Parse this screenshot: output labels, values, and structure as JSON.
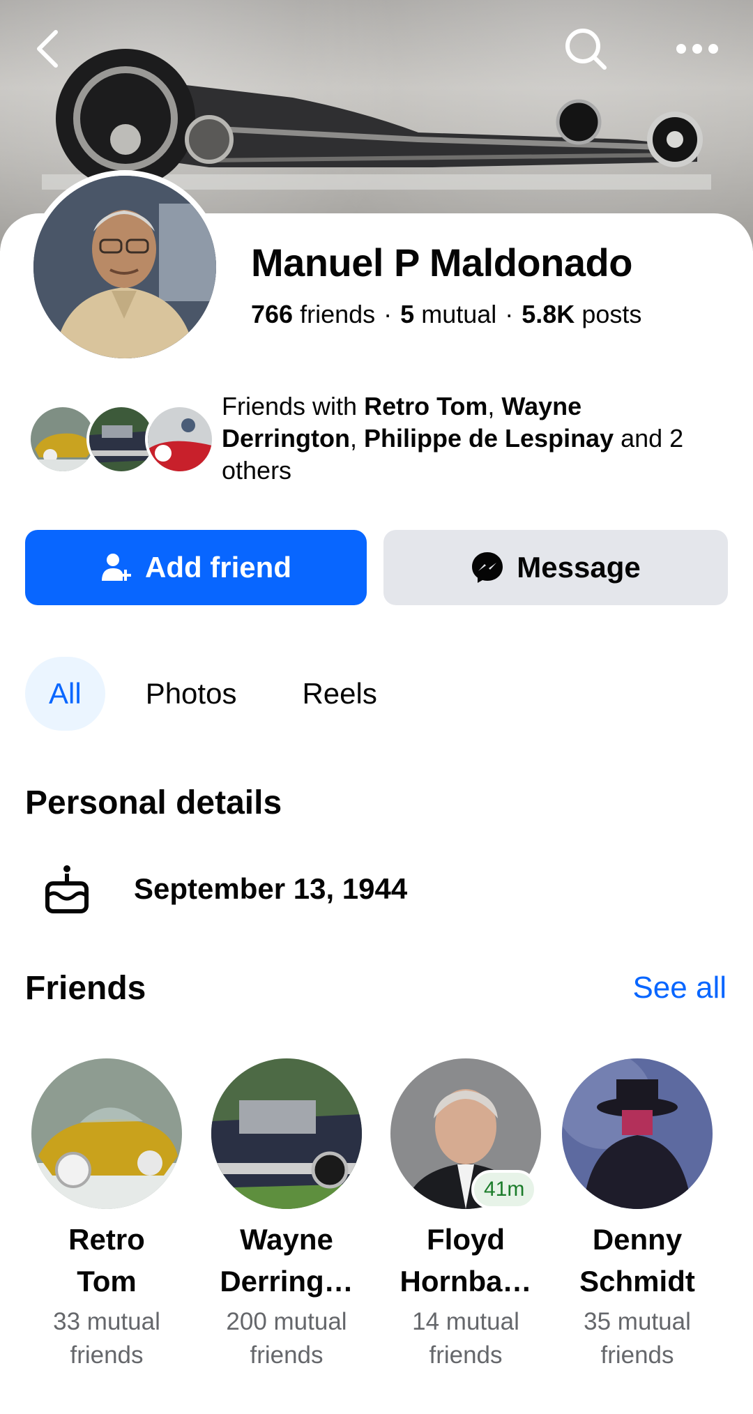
{
  "header": {
    "back_icon": "back-arrow-icon",
    "search_icon": "search-icon",
    "more_icon": "more-dots-icon"
  },
  "profile": {
    "name": "Manuel P Maldonado",
    "friends_count": "766",
    "friends_label": "friends",
    "mutual_count": "5",
    "mutual_label": "mutual",
    "posts_count": "5.8K",
    "posts_label": "posts",
    "separator": "·"
  },
  "mutual_friends": {
    "prefix": "Friends with ",
    "names": [
      "Retro Tom",
      "Wayne Derrington",
      "Philippe de Lespinay"
    ],
    "comma": ", ",
    "suffix": " and 2 others"
  },
  "actions": {
    "add_friend_label": "Add friend",
    "message_label": "Message"
  },
  "tabs": [
    {
      "label": "All",
      "active": true
    },
    {
      "label": "Photos",
      "active": false
    },
    {
      "label": "Reels",
      "active": false
    }
  ],
  "personal_details": {
    "title": "Personal details",
    "birthday": "September 13, 1944",
    "birthday_icon": "cake-icon"
  },
  "friends_section": {
    "title": "Friends",
    "see_all_label": "See all",
    "items": [
      {
        "name_line1": "Retro",
        "name_line2": "Tom",
        "mutual_line1": "33 mutual",
        "mutual_line2": "friends"
      },
      {
        "name_line1": "Wayne",
        "name_line2": "Derring…",
        "mutual_line1": "200 mutual",
        "mutual_line2": "friends"
      },
      {
        "name_line1": "Floyd",
        "name_line2": "Hornba…",
        "mutual_line1": "14 mutual",
        "mutual_line2": "friends",
        "online_badge": "41m"
      },
      {
        "name_line1": "Denny",
        "name_line2": "Schmidt",
        "mutual_line1": "35 mutual",
        "mutual_line2": "friends"
      }
    ]
  },
  "colors": {
    "accent": "#0866ff",
    "secondary_button": "#e4e6eb",
    "active_tab_bg": "#ebf5ff",
    "muted_text": "#65676b",
    "online_badge_bg": "#e7f3e8",
    "online_badge_text": "#1b7c2a"
  }
}
